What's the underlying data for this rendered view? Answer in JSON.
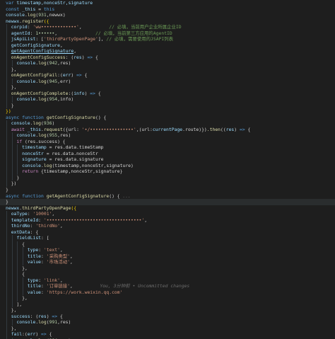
{
  "editor": {
    "active_line": 33,
    "lines": [
      {
        "indent": 0,
        "tokens": [
          {
            "t": "var ",
            "c": "kw"
          },
          {
            "t": "timestamp,nonceStr,signature",
            "c": "var"
          }
        ]
      },
      {
        "indent": 0,
        "tokens": [
          {
            "t": "const ",
            "c": "kw"
          },
          {
            "t": "_this",
            "c": "var"
          },
          {
            "t": " = ",
            "c": "txt"
          },
          {
            "t": "this",
            "c": "kw"
          }
        ]
      },
      {
        "indent": 0,
        "tokens": [
          {
            "t": "console",
            "c": "var"
          },
          {
            "t": ".",
            "c": "txt"
          },
          {
            "t": "log",
            "c": "fn"
          },
          {
            "t": "(",
            "c": "txt"
          },
          {
            "t": "931",
            "c": "num"
          },
          {
            "t": ",newwx)",
            "c": "txt"
          }
        ]
      },
      {
        "indent": 0,
        "tokens": [
          {
            "t": "newwx",
            "c": "var"
          },
          {
            "t": ".",
            "c": "txt"
          },
          {
            "t": "register",
            "c": "fn"
          },
          {
            "t": "({",
            "c": "brace"
          }
        ]
      },
      {
        "indent": 1,
        "tokens": [
          {
            "t": "corpid",
            "c": "prop"
          },
          {
            "t": ": ",
            "c": "txt"
          },
          {
            "t": "'ww•••••••••••••'",
            "c": "str"
          },
          {
            "t": ",          ",
            "c": "txt"
          },
          {
            "t": "// 必填，当前用户企业所属企业ID",
            "c": "cmt"
          }
        ]
      },
      {
        "indent": 1,
        "tokens": [
          {
            "t": "agentId",
            "c": "prop"
          },
          {
            "t": ": ",
            "c": "txt"
          },
          {
            "t": "1••••••",
            "c": "num"
          },
          {
            "t": ",              ",
            "c": "txt"
          },
          {
            "t": "// 必填，当前第三方应用的AgentID",
            "c": "cmt"
          }
        ]
      },
      {
        "indent": 1,
        "tokens": [
          {
            "t": "jsApiList",
            "c": "prop"
          },
          {
            "t": ": [",
            "c": "txt"
          },
          {
            "t": "'thirdPartyOpenPage'",
            "c": "str"
          },
          {
            "t": "], ",
            "c": "txt"
          },
          {
            "t": "// 必填，需要使用的JSAPI列表",
            "c": "cmt"
          }
        ]
      },
      {
        "indent": 1,
        "tokens": [
          {
            "t": "getConfigSignature",
            "c": "var"
          },
          {
            "t": ",",
            "c": "txt"
          }
        ]
      },
      {
        "indent": 1,
        "tokens": [
          {
            "t": "getAgentConfigSignature",
            "c": "link"
          },
          {
            "t": ",",
            "c": "txt"
          }
        ]
      },
      {
        "indent": 1,
        "tokens": [
          {
            "t": "onAgentConfigSuccess",
            "c": "fn"
          },
          {
            "t": ": (",
            "c": "txt"
          },
          {
            "t": "res",
            "c": "var"
          },
          {
            "t": ") ",
            "c": "txt"
          },
          {
            "t": "=>",
            "c": "kw"
          },
          {
            "t": " {",
            "c": "txt"
          }
        ]
      },
      {
        "indent": 2,
        "tokens": [
          {
            "t": "console",
            "c": "var"
          },
          {
            "t": ".",
            "c": "txt"
          },
          {
            "t": "log",
            "c": "fn"
          },
          {
            "t": "(",
            "c": "txt"
          },
          {
            "t": "942",
            "c": "num"
          },
          {
            "t": ",res)",
            "c": "txt"
          }
        ]
      },
      {
        "indent": 1,
        "tokens": [
          {
            "t": "},",
            "c": "txt"
          }
        ]
      },
      {
        "indent": 1,
        "tokens": [
          {
            "t": "onAgentConfigFail",
            "c": "fn"
          },
          {
            "t": ":(",
            "c": "txt"
          },
          {
            "t": "err",
            "c": "var"
          },
          {
            "t": ") ",
            "c": "txt"
          },
          {
            "t": "=>",
            "c": "kw"
          },
          {
            "t": " {",
            "c": "txt"
          }
        ]
      },
      {
        "indent": 2,
        "tokens": [
          {
            "t": "console",
            "c": "var"
          },
          {
            "t": ".",
            "c": "txt"
          },
          {
            "t": "log",
            "c": "fn"
          },
          {
            "t": "(",
            "c": "txt"
          },
          {
            "t": "945",
            "c": "num"
          },
          {
            "t": ",err)",
            "c": "txt"
          }
        ]
      },
      {
        "indent": 1,
        "tokens": [
          {
            "t": "},",
            "c": "txt"
          }
        ]
      },
      {
        "indent": 1,
        "tokens": [
          {
            "t": "onAgentConfigComplete",
            "c": "fn"
          },
          {
            "t": ":(",
            "c": "txt"
          },
          {
            "t": "info",
            "c": "var"
          },
          {
            "t": ") ",
            "c": "txt"
          },
          {
            "t": "=>",
            "c": "kw"
          },
          {
            "t": " {",
            "c": "txt"
          }
        ]
      },
      {
        "indent": 2,
        "tokens": [
          {
            "t": "console",
            "c": "var"
          },
          {
            "t": ".",
            "c": "txt"
          },
          {
            "t": "log",
            "c": "fn"
          },
          {
            "t": "(",
            "c": "txt"
          },
          {
            "t": "954",
            "c": "num"
          },
          {
            "t": ",info)",
            "c": "txt"
          }
        ]
      },
      {
        "indent": 1,
        "tokens": [
          {
            "t": "}",
            "c": "txt"
          }
        ]
      },
      {
        "indent": 0,
        "tokens": [
          {
            "t": "})",
            "c": "brace"
          }
        ]
      },
      {
        "indent": 0,
        "tokens": [
          {
            "t": "async ",
            "c": "kw"
          },
          {
            "t": "function ",
            "c": "kw"
          },
          {
            "t": "getConfigSignature",
            "c": "fn"
          },
          {
            "t": "() {",
            "c": "txt"
          }
        ]
      },
      {
        "indent": 1,
        "tokens": [
          {
            "t": "console",
            "c": "var"
          },
          {
            "t": ".",
            "c": "txt"
          },
          {
            "t": "log",
            "c": "fn"
          },
          {
            "t": "(",
            "c": "txt"
          },
          {
            "t": "936",
            "c": "num"
          },
          {
            "t": ")",
            "c": "txt"
          }
        ]
      },
      {
        "indent": 1,
        "tokens": [
          {
            "t": "await ",
            "c": "ctl"
          },
          {
            "t": "_this",
            "c": "var"
          },
          {
            "t": ".",
            "c": "txt"
          },
          {
            "t": "request",
            "c": "fn"
          },
          {
            "t": "({url: ",
            "c": "txt"
          },
          {
            "t": "'•/••••••••••••••••'",
            "c": "str"
          },
          {
            "t": ",(url:",
            "c": "txt"
          },
          {
            "t": "currentPage",
            "c": "var"
          },
          {
            "t": ".route)})",
            "c": "txt"
          },
          {
            "t": ".then",
            "c": "fn"
          },
          {
            "t": "((",
            "c": "txt"
          },
          {
            "t": "res",
            "c": "var"
          },
          {
            "t": ") ",
            "c": "txt"
          },
          {
            "t": "=>",
            "c": "kw"
          },
          {
            "t": " {",
            "c": "txt"
          }
        ]
      },
      {
        "indent": 2,
        "tokens": [
          {
            "t": "console",
            "c": "var"
          },
          {
            "t": ".",
            "c": "txt"
          },
          {
            "t": "log",
            "c": "fn"
          },
          {
            "t": "(",
            "c": "txt"
          },
          {
            "t": "955",
            "c": "num"
          },
          {
            "t": ",res)",
            "c": "txt"
          }
        ]
      },
      {
        "indent": 2,
        "tokens": [
          {
            "t": "if ",
            "c": "ctl"
          },
          {
            "t": "(res.success) {",
            "c": "txt"
          }
        ]
      },
      {
        "indent": 3,
        "tokens": [
          {
            "t": "timestamp",
            "c": "var"
          },
          {
            "t": " = res.data.timeStamp",
            "c": "txt"
          }
        ]
      },
      {
        "indent": 3,
        "tokens": [
          {
            "t": "nonceStr",
            "c": "var"
          },
          {
            "t": " = res.data.nonceStr",
            "c": "txt"
          }
        ]
      },
      {
        "indent": 3,
        "tokens": [
          {
            "t": "signature",
            "c": "var"
          },
          {
            "t": " = res.data.signature",
            "c": "txt"
          }
        ]
      },
      {
        "indent": 3,
        "tokens": [
          {
            "t": "console",
            "c": "var"
          },
          {
            "t": ".",
            "c": "txt"
          },
          {
            "t": "log",
            "c": "fn"
          },
          {
            "t": "(timestamp,nonceStr,signature)",
            "c": "txt"
          }
        ]
      },
      {
        "indent": 3,
        "tokens": [
          {
            "t": "return ",
            "c": "ctl"
          },
          {
            "t": "{timestamp,nonceStr,signature}",
            "c": "txt"
          }
        ]
      },
      {
        "indent": 2,
        "tokens": [
          {
            "t": "}",
            "c": "txt"
          }
        ]
      },
      {
        "indent": 1,
        "tokens": [
          {
            "t": "})",
            "c": "txt"
          }
        ]
      },
      {
        "indent": 0,
        "tokens": [
          {
            "t": "}",
            "c": "txt"
          }
        ]
      },
      {
        "indent": 0,
        "tokens": [
          {
            "t": "async ",
            "c": "kw"
          },
          {
            "t": "function ",
            "c": "kw"
          },
          {
            "t": "getAgentConfigSignature",
            "c": "fn"
          },
          {
            "t": "() {",
            "c": "txt"
          },
          {
            "t": " ...",
            "c": "ghost"
          }
        ]
      },
      {
        "indent": 0,
        "tokens": [
          {
            "t": "}",
            "c": "txt"
          }
        ]
      },
      {
        "indent": 0,
        "tokens": [
          {
            "t": "newwx",
            "c": "var"
          },
          {
            "t": ".",
            "c": "txt"
          },
          {
            "t": "thirdPartyOpenPage",
            "c": "fn"
          },
          {
            "t": "({",
            "c": "brace"
          }
        ]
      },
      {
        "indent": 1,
        "tokens": [
          {
            "t": "oaType",
            "c": "prop"
          },
          {
            "t": ": ",
            "c": "txt"
          },
          {
            "t": "'10001'",
            "c": "str"
          },
          {
            "t": ",",
            "c": "txt"
          }
        ]
      },
      {
        "indent": 1,
        "tokens": [
          {
            "t": "templateId",
            "c": "prop"
          },
          {
            "t": ": ",
            "c": "txt"
          },
          {
            "t": "'•••••••••••••••••••••••••••••••••••'",
            "c": "str"
          },
          {
            "t": ",",
            "c": "txt"
          }
        ]
      },
      {
        "indent": 1,
        "tokens": [
          {
            "t": "thirdNo",
            "c": "prop"
          },
          {
            "t": ": ",
            "c": "txt"
          },
          {
            "t": "'thirdNo'",
            "c": "str"
          },
          {
            "t": ",",
            "c": "txt"
          }
        ]
      },
      {
        "indent": 1,
        "tokens": [
          {
            "t": "extData",
            "c": "prop"
          },
          {
            "t": ": {",
            "c": "txt"
          }
        ]
      },
      {
        "indent": 2,
        "tokens": [
          {
            "t": "fieldList",
            "c": "prop"
          },
          {
            "t": ": [",
            "c": "txt"
          }
        ]
      },
      {
        "indent": 3,
        "tokens": [
          {
            "t": "{",
            "c": "txt"
          }
        ]
      },
      {
        "indent": 4,
        "tokens": [
          {
            "t": "type",
            "c": "prop"
          },
          {
            "t": ": ",
            "c": "txt"
          },
          {
            "t": "'text'",
            "c": "str"
          },
          {
            "t": ",",
            "c": "txt"
          }
        ]
      },
      {
        "indent": 4,
        "tokens": [
          {
            "t": "title",
            "c": "prop"
          },
          {
            "t": ": ",
            "c": "txt"
          },
          {
            "t": "'采购类型'",
            "c": "str"
          },
          {
            "t": ",",
            "c": "txt"
          }
        ]
      },
      {
        "indent": 4,
        "tokens": [
          {
            "t": "value",
            "c": "prop"
          },
          {
            "t": ": ",
            "c": "txt"
          },
          {
            "t": "'市场活动'",
            "c": "str"
          },
          {
            "t": ",",
            "c": "txt"
          }
        ]
      },
      {
        "indent": 3,
        "tokens": [
          {
            "t": "},",
            "c": "txt"
          }
        ]
      },
      {
        "indent": 3,
        "tokens": [
          {
            "t": "{",
            "c": "txt"
          }
        ]
      },
      {
        "indent": 4,
        "tokens": [
          {
            "t": "type",
            "c": "prop"
          },
          {
            "t": ": ",
            "c": "txt"
          },
          {
            "t": "'link'",
            "c": "str"
          },
          {
            "t": ",",
            "c": "txt"
          }
        ]
      },
      {
        "indent": 4,
        "tokens": [
          {
            "t": "title",
            "c": "prop"
          },
          {
            "t": ": ",
            "c": "txt"
          },
          {
            "t": "'订单链接'",
            "c": "str"
          },
          {
            "t": ",",
            "c": "txt"
          },
          {
            "t": "          You, 3分钟前 • Uncommitted changes",
            "c": "ghost"
          }
        ]
      },
      {
        "indent": 4,
        "tokens": [
          {
            "t": "value",
            "c": "prop"
          },
          {
            "t": ": ",
            "c": "txt"
          },
          {
            "t": "'https://work.weixin.qq.com'",
            "c": "str"
          }
        ]
      },
      {
        "indent": 3,
        "tokens": [
          {
            "t": "},",
            "c": "txt"
          }
        ]
      },
      {
        "indent": 2,
        "tokens": [
          {
            "t": "],",
            "c": "txt"
          }
        ]
      },
      {
        "indent": 1,
        "tokens": [
          {
            "t": "},",
            "c": "txt"
          }
        ]
      },
      {
        "indent": 1,
        "tokens": [
          {
            "t": "success",
            "c": "prop"
          },
          {
            "t": ": (",
            "c": "txt"
          },
          {
            "t": "res",
            "c": "var"
          },
          {
            "t": ") ",
            "c": "txt"
          },
          {
            "t": "=>",
            "c": "kw"
          },
          {
            "t": " {",
            "c": "txt"
          }
        ]
      },
      {
        "indent": 2,
        "tokens": [
          {
            "t": "console",
            "c": "var"
          },
          {
            "t": ".",
            "c": "txt"
          },
          {
            "t": "log",
            "c": "fn"
          },
          {
            "t": "(",
            "c": "txt"
          },
          {
            "t": "991",
            "c": "num"
          },
          {
            "t": ",res)",
            "c": "txt"
          }
        ]
      },
      {
        "indent": 1,
        "tokens": [
          {
            "t": "},",
            "c": "txt"
          }
        ]
      },
      {
        "indent": 1,
        "tokens": [
          {
            "t": "fail",
            "c": "prop"
          },
          {
            "t": ":(",
            "c": "txt"
          },
          {
            "t": "err",
            "c": "var"
          },
          {
            "t": ") ",
            "c": "txt"
          },
          {
            "t": "=>",
            "c": "kw"
          },
          {
            "t": " {",
            "c": "txt"
          }
        ]
      },
      {
        "indent": 2,
        "tokens": [
          {
            "t": "console",
            "c": "var"
          },
          {
            "t": ".",
            "c": "txt"
          },
          {
            "t": "log",
            "c": "fn"
          },
          {
            "t": "(",
            "c": "txt"
          },
          {
            "t": "994",
            "c": "num"
          },
          {
            "t": ",err)",
            "c": "txt"
          }
        ]
      },
      {
        "indent": 1,
        "tokens": [
          {
            "t": "}",
            "c": "txt"
          }
        ]
      },
      {
        "indent": 0,
        "tokens": [
          {
            "t": "})",
            "c": "brace"
          }
        ]
      }
    ]
  },
  "colors": {
    "background": "#1e1e1e",
    "keyword": "#569cd6",
    "control": "#c586c0",
    "function": "#dcdcaa",
    "variable": "#9cdcfe",
    "string": "#ce9178",
    "number": "#b5cea8",
    "comment": "#6a9955"
  }
}
